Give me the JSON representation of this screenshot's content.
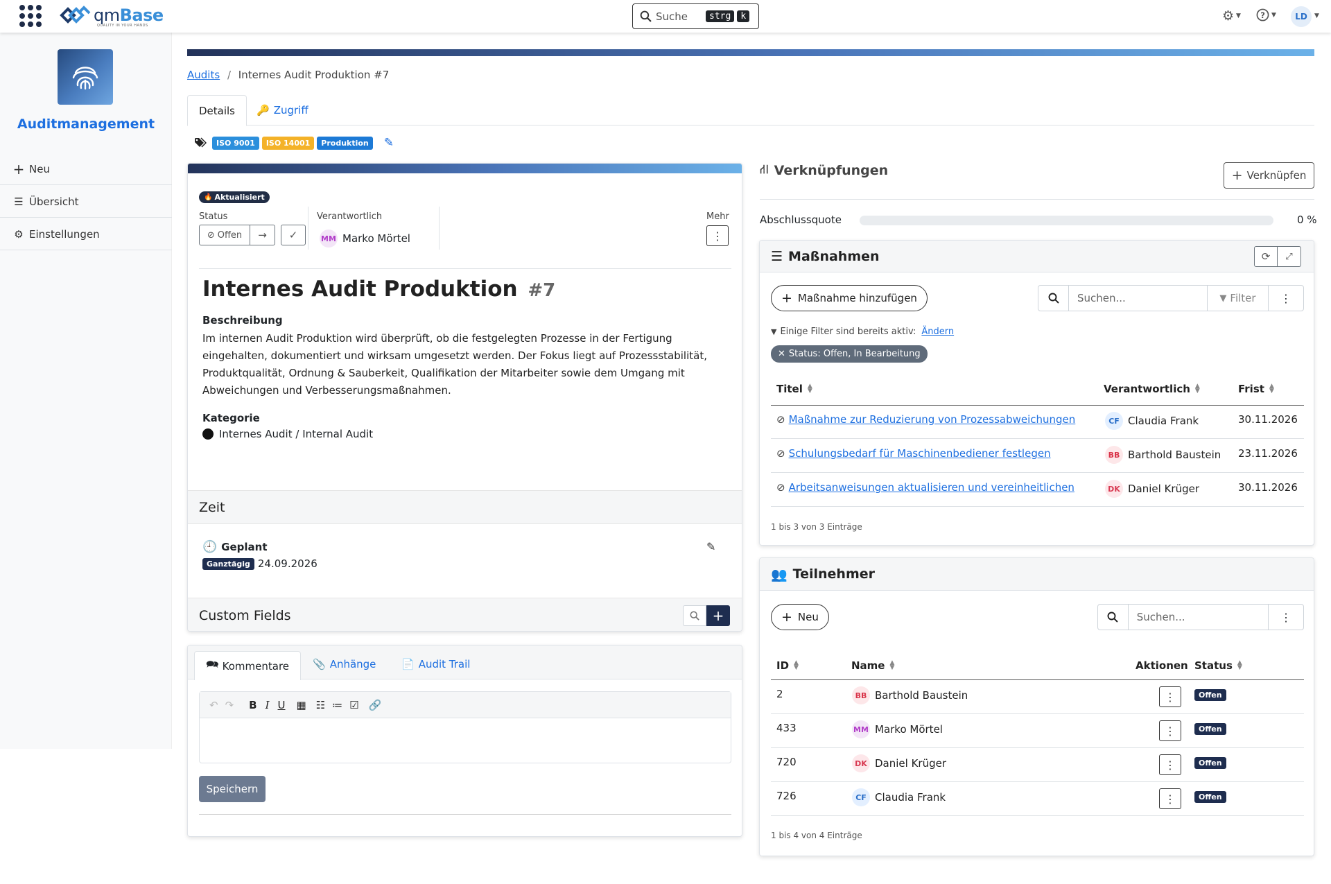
{
  "topbar": {
    "brand_prefix": "qm",
    "brand_suffix": "Base",
    "brand_tagline": "QUALITY IN YOUR HANDS",
    "search_label": "Suche",
    "search_kbd_1": "strg",
    "search_kbd_2": "k",
    "user_initials": "LD"
  },
  "sidebar": {
    "module_title": "Auditmanagement",
    "items": [
      {
        "label": "Neu",
        "icon": "plus-icon"
      },
      {
        "label": "Übersicht",
        "icon": "list-icon"
      },
      {
        "label": "Einstellungen",
        "icon": "gear-icon"
      }
    ]
  },
  "breadcrumb": {
    "link": "Audits",
    "separator": "/",
    "current": "Internes Audit Produktion #7"
  },
  "tabs": {
    "details": "Details",
    "zugriff": "Zugriff"
  },
  "tags": [
    {
      "label": "ISO 9001",
      "color": "#2b8fdc"
    },
    {
      "label": "ISO 14001",
      "color": "#f4b228"
    },
    {
      "label": "Produktion",
      "color": "#1d7ad6"
    }
  ],
  "audit": {
    "updated_badge": "Aktualisiert",
    "status_label": "Status",
    "status_value": "Offen",
    "responsible_label": "Verantwortlich",
    "responsible_initials": "MM",
    "responsible_name": "Marko Mörtel",
    "more_label": "Mehr",
    "title": "Internes Audit Produktion",
    "number": "#7",
    "description_label": "Beschreibung",
    "description": "Im internen Audit Produktion wird überprüft, ob die festgelegten Prozesse in der Fertigung eingehalten, dokumentiert und wirksam umgesetzt werden. Der Fokus liegt auf Prozessstabilität, Produktqualität, Ordnung & Sauberkeit, Qualifikation der Mitarbeiter sowie dem Umgang mit Abweichungen und Verbesserungsmaßnahmen.",
    "category_label": "Kategorie",
    "category_value": "Internes Audit / Internal Audit",
    "time_header": "Zeit",
    "planned_label": "Geplant",
    "allday_badge": "Ganztägig",
    "planned_date": "24.09.2026",
    "custom_fields_header": "Custom Fields"
  },
  "comments": {
    "tab_comments": "Kommentare",
    "tab_attachments": "Anhänge",
    "tab_audit_trail": "Audit Trail",
    "save_label": "Speichern"
  },
  "links": {
    "title": "Verknüpfungen",
    "link_button": "Verknüpfen",
    "completion_label": "Abschlussquote",
    "completion_value": "0 %",
    "completion_fraction": 0
  },
  "measures": {
    "title": "Maßnahmen",
    "add_button": "Maßnahme hinzufügen",
    "search_placeholder": "Suchen...",
    "filter_label": "Filter",
    "filter_info": "Einige Filter sind bereits aktiv:",
    "filter_change": "Ändern",
    "filter_chip": "Status: Offen, In Bearbeitung",
    "columns": {
      "title": "Titel",
      "responsible": "Verantwortlich",
      "deadline": "Frist"
    },
    "rows": [
      {
        "title": "Maßnahme zur Reduzierung von Prozessabweichungen",
        "initials": "CF",
        "name": "Claudia Frank",
        "deadline": "30.11.2026"
      },
      {
        "title": "Schulungsbedarf für Maschinenbediener festlegen",
        "initials": "BB",
        "name": "Barthold Baustein",
        "deadline": "23.11.2026"
      },
      {
        "title": "Arbeitsanweisungen aktualisieren und vereinheitlichen",
        "initials": "DK",
        "name": "Daniel Krüger",
        "deadline": "30.11.2026"
      }
    ],
    "footer": "1 bis 3 von 3 Einträge"
  },
  "participants": {
    "title": "Teilnehmer",
    "new_button": "Neu",
    "search_placeholder": "Suchen...",
    "columns": {
      "id": "ID",
      "name": "Name",
      "actions": "Aktionen",
      "status": "Status"
    },
    "rows": [
      {
        "id": "2",
        "initials": "BB",
        "name": "Barthold Baustein",
        "status": "Offen"
      },
      {
        "id": "433",
        "initials": "MM",
        "name": "Marko Mörtel",
        "status": "Offen"
      },
      {
        "id": "720",
        "initials": "DK",
        "name": "Daniel Krüger",
        "status": "Offen"
      },
      {
        "id": "726",
        "initials": "CF",
        "name": "Claudia Frank",
        "status": "Offen"
      }
    ],
    "footer": "1 bis 4 von 4 Einträge"
  }
}
